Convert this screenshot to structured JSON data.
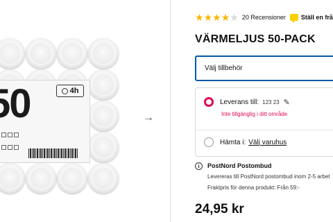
{
  "product": {
    "title": "VÄRMELJUS 50-PACK",
    "price": "24,95 kr",
    "rating": {
      "stars": 4,
      "max": 5,
      "reviews_label": "20 Recensioner"
    },
    "ask_label": "Ställ en fråga",
    "image": {
      "pack_number": "50",
      "burn_time": "4h",
      "icons": [
        "clock-icon"
      ]
    }
  },
  "accessory": {
    "label": "Välj tillbehör"
  },
  "delivery": {
    "label": "Leverans till:",
    "zip": "123 23",
    "unavailable": "Inte tillgänglig i ditt område",
    "selected": true
  },
  "pickup": {
    "label": "Hämta i:",
    "store_link": "Välj varuhus"
  },
  "postnord": {
    "title": "PostNord Postombud",
    "description": "Levereras till PostNord postombud inom 2-5 arbet",
    "shipping": "Fraktpris för denna produkt: Från 59:-"
  },
  "colors": {
    "accent_blue": "#0058a3",
    "accent_red": "#e00751",
    "star_yellow": "#f5b800"
  }
}
